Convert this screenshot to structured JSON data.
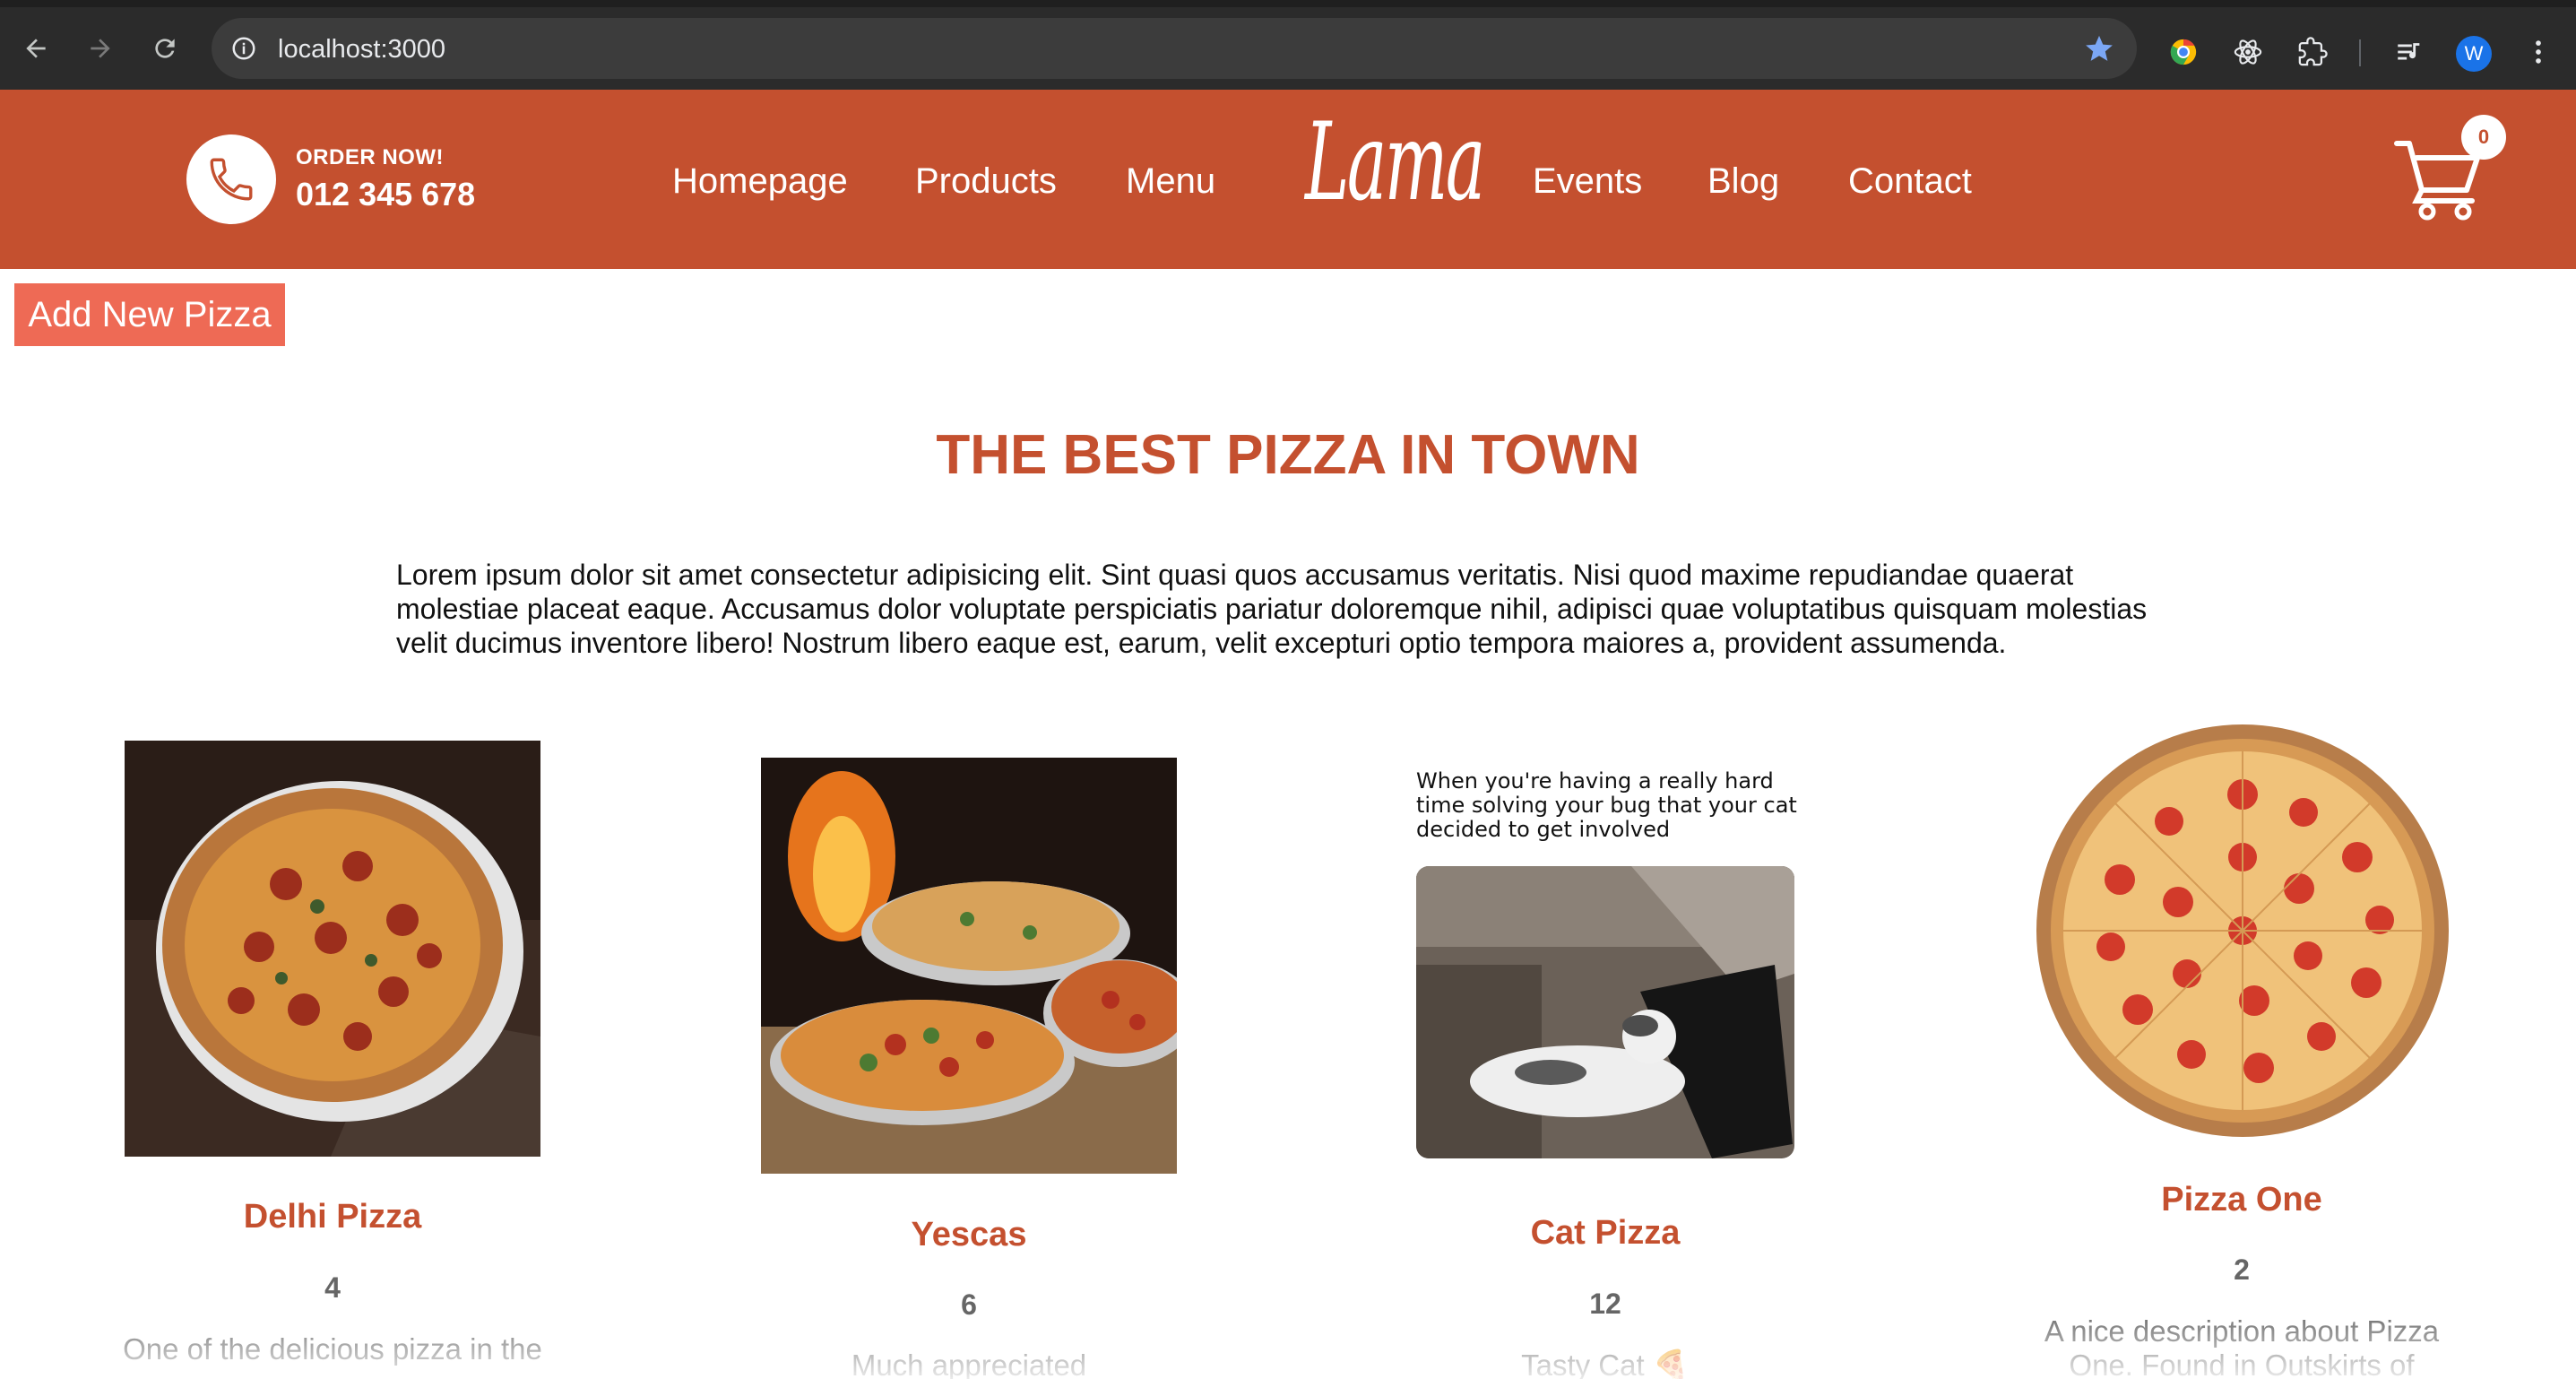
{
  "browser": {
    "url": "localhost:3000",
    "profile_initial": "W"
  },
  "header": {
    "order_label": "ORDER NOW!",
    "phone": "012 345 678",
    "nav_left": [
      "Homepage",
      "Products",
      "Menu"
    ],
    "logo": "Lama",
    "nav_right": [
      "Events",
      "Blog",
      "Contact"
    ],
    "cart_count": "0",
    "color": "#c4502f"
  },
  "main": {
    "add_button": "Add New Pizza",
    "add_button_color": "#ee6a55",
    "title": "THE BEST PIZZA IN TOWN",
    "description": "Lorem ipsum dolor sit amet consectetur adipisicing elit. Sint quasi quos accusamus veritatis. Nisi quod maxime repudiandae quaerat molestiae placeat eaque. Accusamus dolor voluptate perspiciatis pariatur doloremque nihil, adipisci quae voluptatibus quisquam molestias velit ducimus inventore libero! Nostrum libero eaque est, earum, velit excepturi optio tempora maiores a, provident assumenda."
  },
  "products": [
    {
      "name": "Delhi Pizza",
      "price": "4",
      "description": "One of the delicious pizza in the"
    },
    {
      "name": "Yescas",
      "price": "6",
      "description": "Much appreciated"
    },
    {
      "name": "Cat Pizza",
      "price": "12",
      "description": "Tasty Cat 🍕",
      "image_caption": "When you're having a really hard time solving your bug that your cat decided to get involved"
    },
    {
      "name": "Pizza One",
      "price": "2",
      "description": "A nice description about Pizza One. Found in Outskirts of"
    }
  ]
}
